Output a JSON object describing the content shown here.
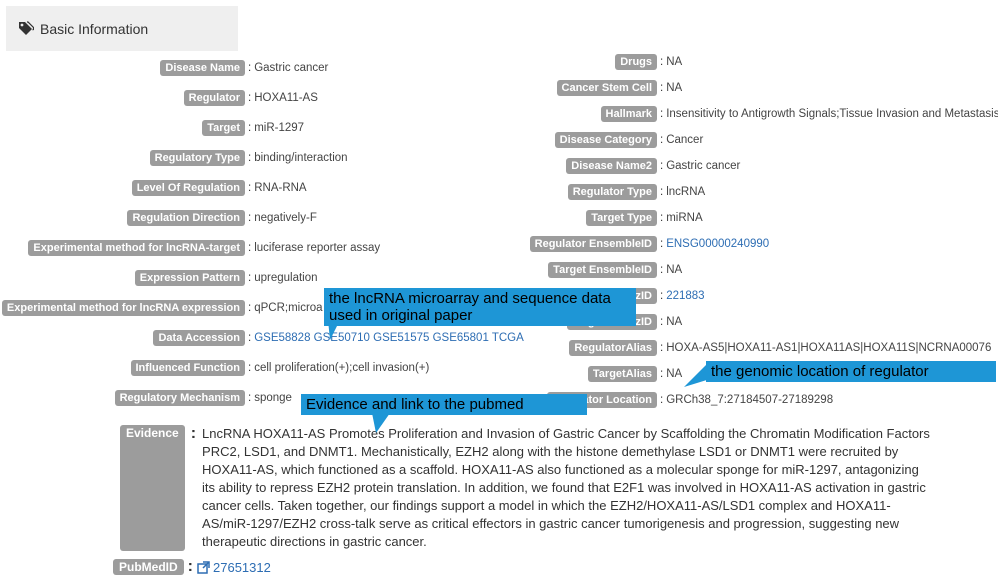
{
  "header": {
    "title": "Basic Information",
    "icon": "tag-icon"
  },
  "left_fields": [
    {
      "label": "Disease Name",
      "value": "Gastric cancer"
    },
    {
      "label": "Regulator",
      "value": "HOXA11-AS"
    },
    {
      "label": "Target",
      "value": "miR-1297"
    },
    {
      "label": "Regulatory Type",
      "value": "binding/interaction"
    },
    {
      "label": "Level Of Regulation",
      "value": "RNA-RNA"
    },
    {
      "label": "Regulation Direction",
      "value": "negatively-F"
    },
    {
      "label": "Experimental method for lncRNA-target",
      "value": "luciferase reporter assay"
    },
    {
      "label": "Expression Pattern",
      "value": "upregulation"
    },
    {
      "label": "Experimental method for lncRNA expression",
      "value": "qPCR;microa"
    },
    {
      "label": "Data Accession",
      "value": "GSE58828 GSE50710 GSE51575 GSE65801 TCGA",
      "link": true
    },
    {
      "label": "Influenced Function",
      "value": "cell proliferation(+);cell invasion(+)"
    },
    {
      "label": "Regulatory Mechanism",
      "value": "sponge"
    }
  ],
  "right_fields": [
    {
      "label": "Drugs",
      "value": "NA"
    },
    {
      "label": "Cancer Stem Cell",
      "value": "NA"
    },
    {
      "label": "Hallmark",
      "value": "Insensitivity to Antigrowth Signals;Tissue Invasion and Metastasis"
    },
    {
      "label": "Disease Category",
      "value": "Cancer"
    },
    {
      "label": "Disease Name2",
      "value": "Gastric cancer"
    },
    {
      "label": "Regulator Type",
      "value": "lncRNA"
    },
    {
      "label": "Target Type",
      "value": "miRNA"
    },
    {
      "label": "Regulator EnsembleID",
      "value": "ENSG00000240990",
      "link": true
    },
    {
      "label": "Target EnsembleID",
      "value": "NA"
    },
    {
      "label": "Regulator EntrezID",
      "value": "221883",
      "link": true
    },
    {
      "label": "Target EntrezID",
      "value": "NA"
    },
    {
      "label": "RegulatorAlias",
      "value": "HOXA-AS5|HOXA11-AS1|HOXA11AS|HOXA11S|NCRNA00076"
    },
    {
      "label": "TargetAlias",
      "value": "NA"
    },
    {
      "label": "Regulator Location",
      "value": "GRCh38_7:27184507-27189298"
    }
  ],
  "evidence": {
    "label": "Evidence",
    "text": "LncRNA HOXA11-AS Promotes Proliferation and Invasion of Gastric Cancer by Scaffolding the Chromatin Modification Factors PRC2, LSD1, and DNMT1. Mechanistically, EZH2 along with the histone demethylase LSD1 or DNMT1 were recruited by HOXA11-AS, which functioned as a scaffold. HOXA11-AS also functioned as a molecular sponge for miR-1297, antagonizing its ability to repress EZH2 protein translation. In addition, we found that E2F1 was involved in HOXA11-AS activation in gastric cancer cells. Taken together, our findings support a model in which the EZH2/HOXA11-AS/LSD1 complex and HOXA11-AS/miR-1297/EZH2 cross-talk serve as critical effectors in gastric cancer tumorigenesis and progression, suggesting new therapeutic directions in gastric cancer."
  },
  "pubmed": {
    "label": "PubMedID",
    "value": "27651312",
    "icon": "external-link-icon"
  },
  "callouts": {
    "microarray": "the lncRNA microarray and sequence data used in original paper",
    "genomic": "the genomic location of regulator",
    "evidence": "Evidence and link to the pubmed"
  },
  "colors": {
    "label_bg": "#9c9c9c",
    "link": "#2d6db3",
    "callout_bg": "#1e96d6",
    "header_bg": "#efefef"
  }
}
